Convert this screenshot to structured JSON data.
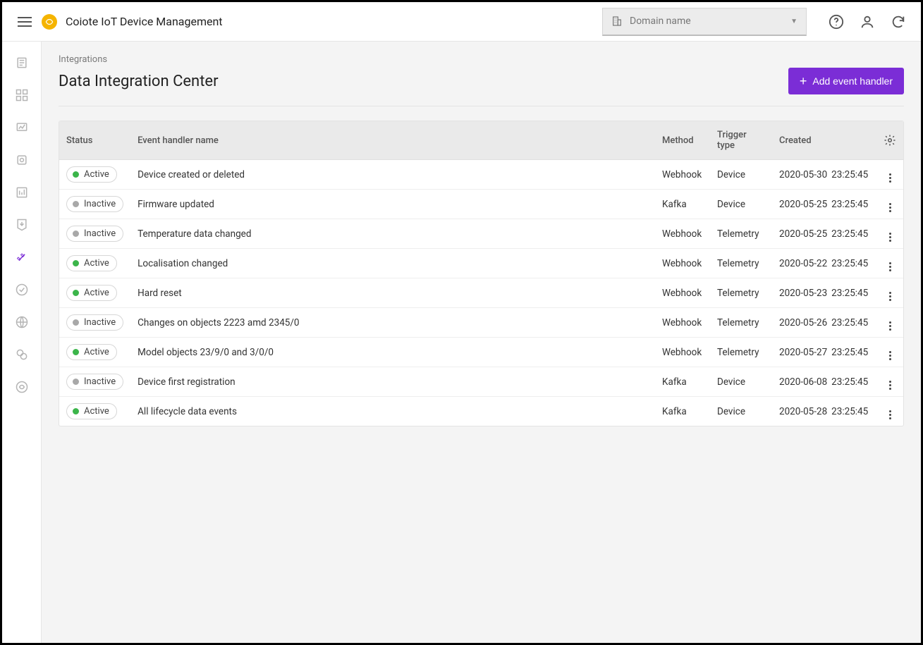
{
  "header": {
    "app_title": "Coiote IoT Device Management",
    "domain_placeholder": "Domain name"
  },
  "page": {
    "breadcrumb": "Integrations",
    "title": "Data Integration Center",
    "add_button": "Add event handler"
  },
  "table": {
    "columns": {
      "status": "Status",
      "name": "Event handler name",
      "method": "Method",
      "trigger": "Trigger type",
      "created": "Created"
    },
    "status_labels": {
      "active": "Active",
      "inactive": "Inactive"
    },
    "rows": [
      {
        "status": "active",
        "name": "Device created or deleted",
        "method": "Webhook",
        "trigger": "Device",
        "created_date": "2020-05-30",
        "created_time": "23:25:45"
      },
      {
        "status": "inactive",
        "name": "Firmware updated",
        "method": "Kafka",
        "trigger": "Device",
        "created_date": "2020-05-25",
        "created_time": "23:25:45"
      },
      {
        "status": "inactive",
        "name": "Temperature data changed",
        "method": "Webhook",
        "trigger": "Telemetry",
        "created_date": "2020-05-25",
        "created_time": "23:25:45"
      },
      {
        "status": "active",
        "name": "Localisation changed",
        "method": "Webhook",
        "trigger": "Telemetry",
        "created_date": "2020-05-22",
        "created_time": "23:25:45"
      },
      {
        "status": "active",
        "name": "Hard reset",
        "method": "Webhook",
        "trigger": "Telemetry",
        "created_date": "2020-05-23",
        "created_time": "23:25:45"
      },
      {
        "status": "inactive",
        "name": "Changes on objects 2223 amd 2345/0",
        "method": "Webhook",
        "trigger": "Telemetry",
        "created_date": "2020-05-26",
        "created_time": "23:25:45"
      },
      {
        "status": "active",
        "name": "Model objects 23/9/0 and 3/0/0",
        "method": "Webhook",
        "trigger": "Telemetry",
        "created_date": "2020-05-27",
        "created_time": "23:25:45"
      },
      {
        "status": "inactive",
        "name": "Device first registration",
        "method": "Kafka",
        "trigger": "Device",
        "created_date": "2020-06-08",
        "created_time": "23:25:45"
      },
      {
        "status": "active",
        "name": "All lifecycle data events",
        "method": "Kafka",
        "trigger": "Device",
        "created_date": "2020-05-28",
        "created_time": "23:25:45"
      }
    ]
  },
  "sidebar": {
    "items": [
      {
        "name": "sidebar-devices-icon"
      },
      {
        "name": "sidebar-groups-icon"
      },
      {
        "name": "sidebar-monitoring-icon"
      },
      {
        "name": "sidebar-config-icon"
      },
      {
        "name": "sidebar-analytics-icon"
      },
      {
        "name": "sidebar-download-icon"
      },
      {
        "name": "sidebar-integrations-icon"
      },
      {
        "name": "sidebar-tasks-icon"
      },
      {
        "name": "sidebar-globe-icon"
      },
      {
        "name": "sidebar-link-icon"
      },
      {
        "name": "sidebar-settings-icon"
      }
    ],
    "active_index": 6
  }
}
